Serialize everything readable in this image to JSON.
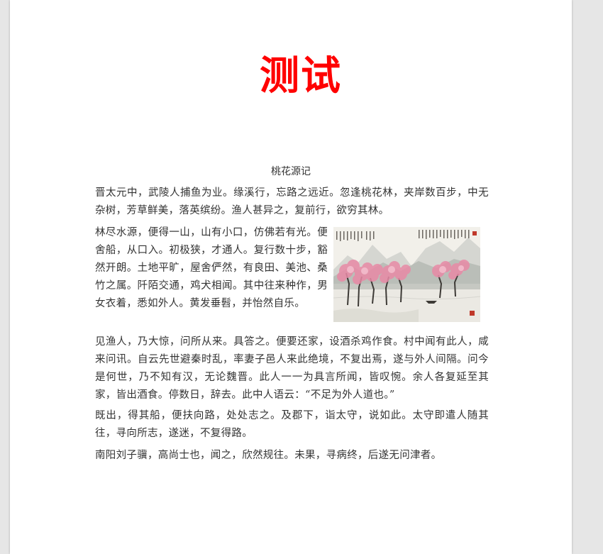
{
  "document": {
    "title": "测试",
    "heading": "桃花源记",
    "paragraphs": [
      "晋太元中，武陵人捕鱼为业。缘溪行，忘路之远近。忽逢桃花林，夹岸数百步，中无杂树，芳草鲜美，落英缤纷。渔人甚异之，复前行，欲穷其林。",
      "林尽水源，便得一山，山有小口，仿佛若有光。便舍船，从口入。初极狭，才通人。复行数十步，豁然开朗。土地平旷，屋舍俨然，有良田、美池、桑竹之属。阡陌交通，鸡犬相闻。其中往来种作，男女衣着，悉如外人。黄发垂髫，并怡然自乐。",
      "见渔人，乃大惊，问所从来。具答之。便要还家，设酒杀鸡作食。村中闻有此人，咸来问讯。自云先世避秦时乱，率妻子邑人来此绝境，不复出焉，遂与外人间隔。问今是何世，乃不知有汉，无论魏晋。此人一一为具言所闻，皆叹惋。余人各复延至其家，皆出酒食。停数日，辞去。此中人语云：“不足为外人道也。”",
      "既出，得其船，便扶向路，处处志之。及郡下，诣太守，说如此。太守即遣人随其往，寻向所志，遂迷，不复得路。",
      "南阳刘子骥，高尚士也，闻之，欣然规往。未果，寻病终，后遂无问津者。"
    ]
  },
  "colors": {
    "title": "#ff0000",
    "text": "#333333",
    "page": "#ffffff",
    "background": "#e6e6e6"
  },
  "image": {
    "subject": "peach-blossom-landscape-painting"
  }
}
